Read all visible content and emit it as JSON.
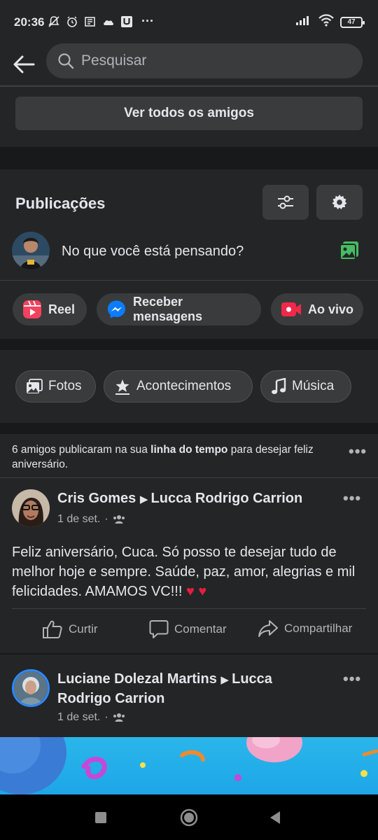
{
  "status_bar": {
    "time": "20:36",
    "battery": "47",
    "more": "···"
  },
  "search": {
    "placeholder": "Pesquisar"
  },
  "friends": {
    "see_all_label": "Ver todos os amigos"
  },
  "publications": {
    "title": "Publicações",
    "composer_prompt": "No que você está pensando?",
    "chips": [
      "Reel",
      "Receber mensagens",
      "Ao vivo"
    ]
  },
  "filters": [
    "Fotos",
    "Acontecimentos",
    "Música"
  ],
  "notice": {
    "prefix": "6 amigos publicaram na sua ",
    "bold": "linha do tempo",
    "suffix": " para desejar feliz aniversário."
  },
  "posts": [
    {
      "author": "Cris Gomes",
      "target": "Lucca Rodrigo Carrion",
      "date": "1 de set.",
      "body": "Feliz aniversário,  Cuca. Só posso te desejar tudo de melhor hoje e sempre.  Saúde,  paz, amor, alegrias e mil felicidades.  AMAMOS VC!!!",
      "hearts": "♥ ♥",
      "actions": [
        "Curtir",
        "Comentar",
        "Compartilhar"
      ]
    },
    {
      "author": "Luciane Dolezal Martins",
      "target": "Lucca",
      "target_cont": "Rodrigo Carrion",
      "date": "1 de set."
    }
  ],
  "colors": {
    "background": "#18191a",
    "card": "#242526",
    "button": "#3a3b3c",
    "text": "#e4e6eb",
    "secondary_text": "#b0b3b8",
    "reel": "#f3425f",
    "messenger": "#0a7cff",
    "live": "#f02849",
    "photo_green": "#45bd62"
  },
  "icons": [
    "back-arrow-icon",
    "search-icon",
    "filter-sliders-icon",
    "gear-icon",
    "photo-icon",
    "reel-icon",
    "messenger-icon",
    "live-video-icon",
    "image-icon",
    "star-event-icon",
    "music-note-icon",
    "like-icon",
    "comment-icon",
    "share-icon",
    "friends-audience-icon",
    "more-dots-icon"
  ]
}
